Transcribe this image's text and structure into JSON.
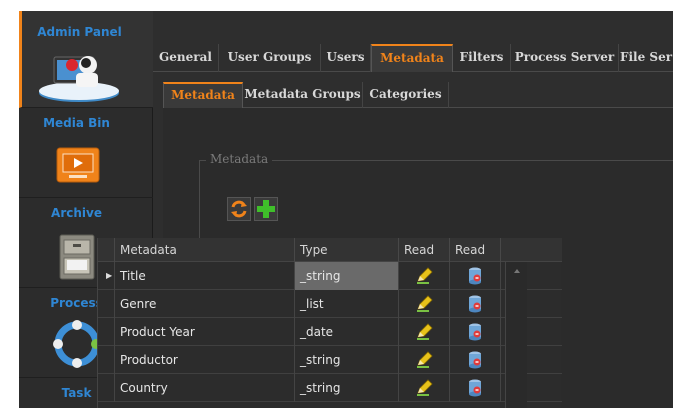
{
  "sidebar": {
    "sections": [
      {
        "label": "Admin Panel",
        "icon": "admin-user-icon",
        "active": true
      },
      {
        "label": "Media Bin",
        "icon": "media-monitor-icon",
        "active": false
      },
      {
        "label": "Archive",
        "icon": "archive-cabinet-icon",
        "active": false
      },
      {
        "label": "Process",
        "icon": "process-cycle-icon",
        "active": false
      },
      {
        "label": "Task",
        "icon": "task-icon",
        "active": false
      }
    ]
  },
  "tabs": [
    {
      "label": "General",
      "active": false
    },
    {
      "label": "User Groups",
      "active": false
    },
    {
      "label": "Users",
      "active": false
    },
    {
      "label": "Metadata",
      "active": true
    },
    {
      "label": "Filters",
      "active": false
    },
    {
      "label": "Process Server",
      "active": false
    },
    {
      "label": "File Ser",
      "active": false
    }
  ],
  "subtabs": [
    {
      "label": "Metadata",
      "active": true
    },
    {
      "label": "Metadata Groups",
      "active": false
    },
    {
      "label": "Categories",
      "active": false
    }
  ],
  "group_title": "Metadata",
  "toolbar": {
    "refresh_icon": "refresh-icon",
    "add_icon": "add-icon"
  },
  "grid": {
    "columns": [
      "Metadata",
      "Type",
      "Read",
      "Read"
    ],
    "rows": [
      {
        "metadata": "Title",
        "type": "_string",
        "selected": true
      },
      {
        "metadata": "Genre",
        "type": "_list",
        "selected": false
      },
      {
        "metadata": "Product Year",
        "type": "_date",
        "selected": false
      },
      {
        "metadata": "Productor",
        "type": "_string",
        "selected": false
      },
      {
        "metadata": "Country",
        "type": "_string",
        "selected": false
      }
    ]
  },
  "colors": {
    "accent": "#f0831a",
    "sidebar_label": "#2f86d3",
    "add_green": "#3fbf2a"
  }
}
